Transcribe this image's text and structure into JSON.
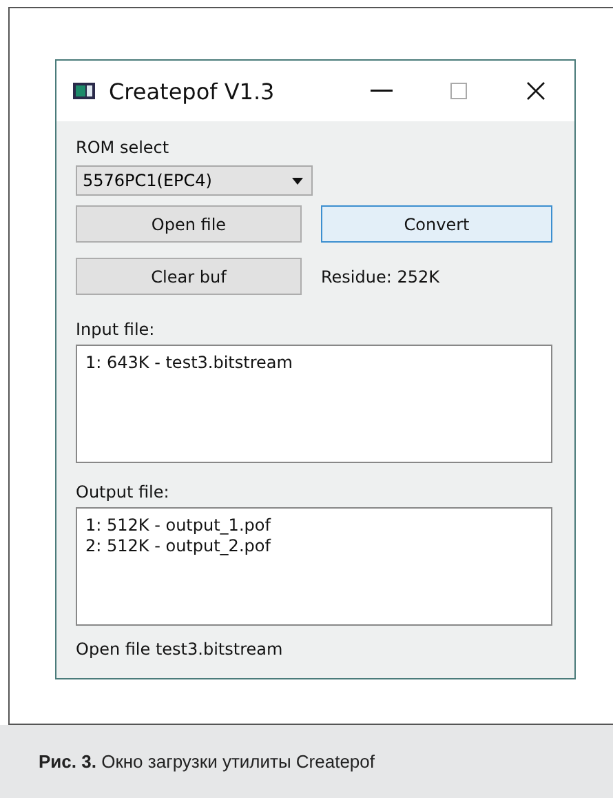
{
  "window": {
    "title": "Createpof V1.3"
  },
  "rom_select": {
    "label": "ROM select",
    "value": "5576PC1(EPC4)"
  },
  "buttons": [
    {
      "label": "Open file",
      "default": false
    },
    {
      "label": "Convert",
      "default": true
    },
    {
      "label": "Clear buf",
      "default": false
    }
  ],
  "residue": "Residue: 252K",
  "input_file": {
    "label": "Input file:",
    "lines": [
      "1: 643K - test3.bitstream"
    ]
  },
  "output_file": {
    "label": "Output file:",
    "lines": [
      "1: 512K - output_1.pof",
      "2: 512K - output_2.pof"
    ]
  },
  "status": "Open file test3.bitstream",
  "caption": "**Рис. 3.** Окно загрузки утилиты Createpof"
}
